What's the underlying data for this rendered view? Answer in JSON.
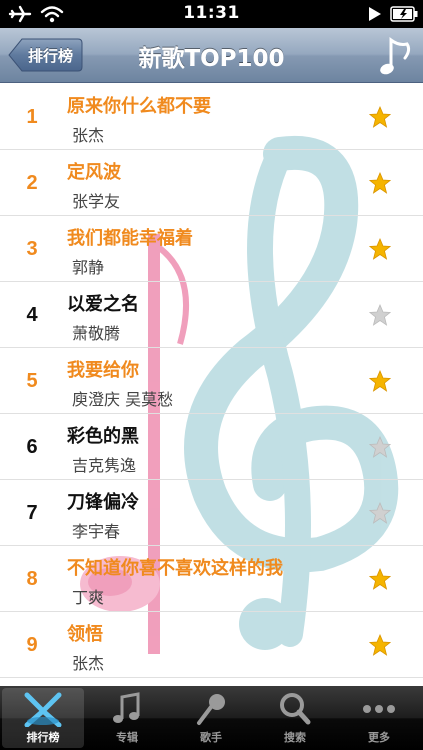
{
  "status_bar": {
    "time": "11:31"
  },
  "nav": {
    "back_label": "排行榜",
    "title": "新歌TOP100"
  },
  "songs": [
    {
      "rank": "1",
      "title": "原来你什么都不要",
      "artist": "张杰",
      "hot": true,
      "starred": true
    },
    {
      "rank": "2",
      "title": "定风波",
      "artist": "张学友",
      "hot": true,
      "starred": true
    },
    {
      "rank": "3",
      "title": "我们都能幸福着",
      "artist": "郭静",
      "hot": true,
      "starred": true
    },
    {
      "rank": "4",
      "title": "以爱之名",
      "artist": "萧敬腾",
      "hot": false,
      "starred": false
    },
    {
      "rank": "5",
      "title": "我要给你",
      "artist": "庾澄庆 吴莫愁",
      "hot": true,
      "starred": true
    },
    {
      "rank": "6",
      "title": "彩色的黑",
      "artist": "吉克隽逸",
      "hot": false,
      "starred": false
    },
    {
      "rank": "7",
      "title": "刀锋偏冷",
      "artist": "李宇春",
      "hot": false,
      "starred": false
    },
    {
      "rank": "8",
      "title": "不知道你喜不喜欢这样的我",
      "artist": "丁爽",
      "hot": true,
      "starred": true
    },
    {
      "rank": "9",
      "title": "领悟",
      "artist": "张杰",
      "hot": true,
      "starred": true
    }
  ],
  "tabs": [
    {
      "label": "排行榜",
      "icon": "chart-icon",
      "active": true
    },
    {
      "label": "专辑",
      "icon": "music-note-icon",
      "active": false
    },
    {
      "label": "歌手",
      "icon": "microphone-icon",
      "active": false
    },
    {
      "label": "搜索",
      "icon": "search-icon",
      "active": false
    },
    {
      "label": "更多",
      "icon": "more-icon",
      "active": false
    }
  ],
  "colors": {
    "hot": "#f08a1e",
    "cold": "#111111",
    "star_on": "#f5b400",
    "star_off": "#d0d0d0"
  }
}
